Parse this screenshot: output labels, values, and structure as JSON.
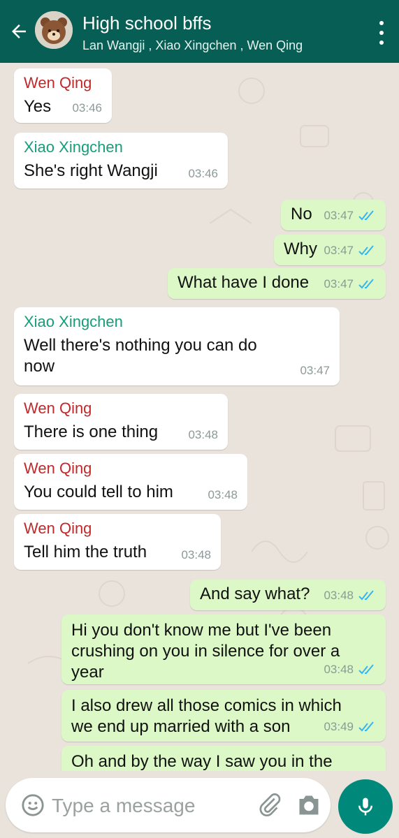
{
  "header": {
    "title": "High school bffs",
    "subtitle": "Lan Wangji , Xiao Xingchen , Wen Qing"
  },
  "messages": [
    {
      "dir": "in",
      "sender": "Wen Qing",
      "text": "Yes",
      "time": "03:46"
    },
    {
      "dir": "in",
      "sender": "Xiao Xingchen",
      "text": "She's right Wangji",
      "time": "03:46"
    },
    {
      "dir": "out",
      "text": "No",
      "time": "03:47"
    },
    {
      "dir": "out",
      "text": "Why",
      "time": "03:47"
    },
    {
      "dir": "out",
      "text": "What have I done",
      "time": "03:47"
    },
    {
      "dir": "in",
      "sender": "Xiao Xingchen",
      "text": "Well there's nothing you can do now",
      "time": "03:47"
    },
    {
      "dir": "in",
      "sender": "Wen Qing",
      "text": "There is one thing",
      "time": "03:48"
    },
    {
      "dir": "in",
      "sender": "Wen Qing",
      "text": "You could tell to him",
      "time": "03:48"
    },
    {
      "dir": "in",
      "sender": "Wen Qing",
      "text": "Tell him the truth",
      "time": "03:48"
    },
    {
      "dir": "out",
      "text": "And say what?",
      "time": "03:48"
    },
    {
      "dir": "out",
      "text": "Hi you don't know me but I've been crushing on you in silence for over a year",
      "time": "03:48"
    },
    {
      "dir": "out",
      "text": "I also drew all those comics in which we end up married with a son",
      "time": "03:49"
    },
    {
      "dir": "out",
      "text": "Oh and by the way I saw you in the",
      "time": ""
    }
  ],
  "input": {
    "placeholder": "Type a message"
  },
  "colors": {
    "header": "#075e54",
    "outgoing_bubble": "#dcf8c6",
    "incoming_bubble": "#ffffff",
    "read_ticks": "#34b7f1",
    "mic_button": "#00897b"
  },
  "icons": [
    "back-arrow-icon",
    "group-avatar",
    "more-vert-icon",
    "emoji-icon",
    "attach-icon",
    "camera-icon",
    "mic-icon",
    "double-check-icon"
  ]
}
